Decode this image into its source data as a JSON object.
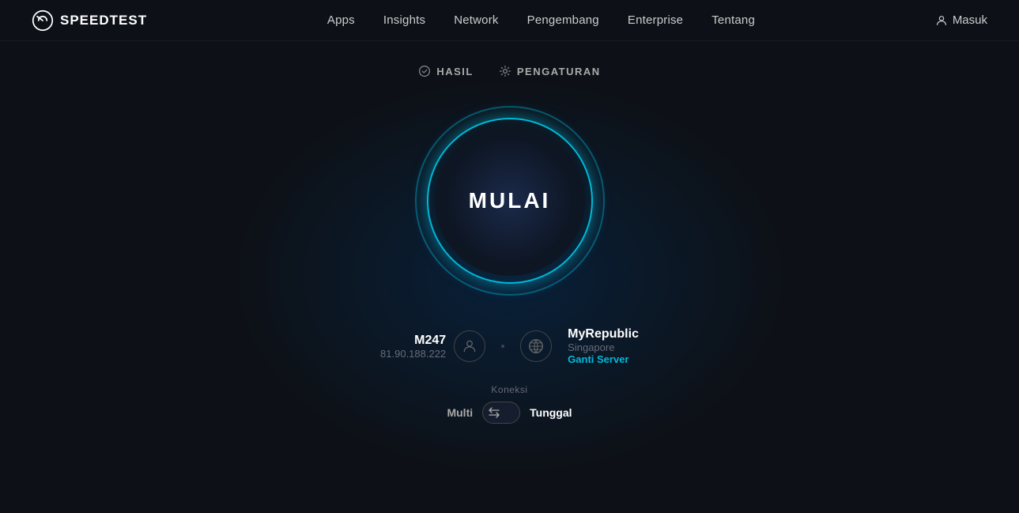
{
  "brand": {
    "name": "SPEEDTEST"
  },
  "nav": {
    "links": [
      {
        "label": "Apps",
        "active": false
      },
      {
        "label": "Insights",
        "active": false
      },
      {
        "label": "Network",
        "active": false
      },
      {
        "label": "Pengembang",
        "active": false
      },
      {
        "label": "Enterprise",
        "active": false
      },
      {
        "label": "Tentang",
        "active": false
      }
    ],
    "masuk_label": "Masuk"
  },
  "tabs": [
    {
      "label": "HASIL",
      "icon": "checkmark",
      "active": false
    },
    {
      "label": "PENGATURAN",
      "icon": "gear",
      "active": false
    }
  ],
  "start_button": {
    "label": "MULAI"
  },
  "isp": {
    "name": "M247",
    "ip": "81.90.188.222"
  },
  "server": {
    "name": "MyRepublic",
    "location": "Singapore",
    "change_label": "Ganti Server"
  },
  "koneksi": {
    "label": "Koneksi",
    "multi_label": "Multi",
    "single_label": "Tunggal"
  }
}
